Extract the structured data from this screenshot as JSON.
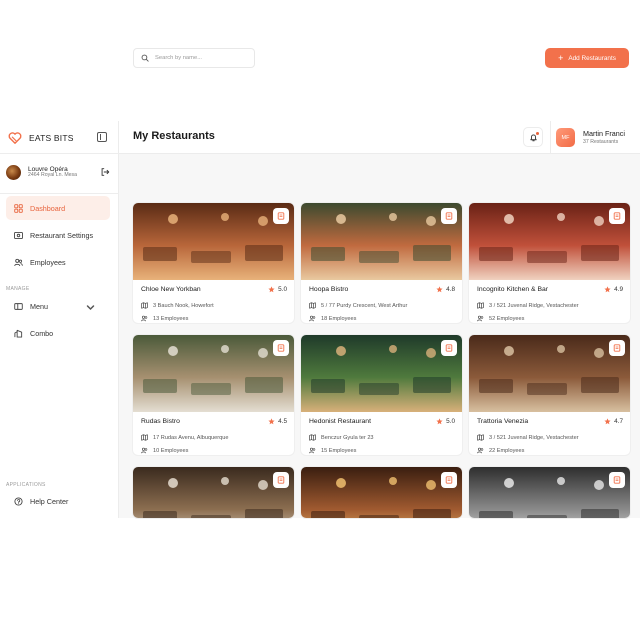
{
  "brand": {
    "name": "EATS BITS",
    "logo_icon": "heart-slice-logo",
    "accent": "#f2714b"
  },
  "location": {
    "name": "Louvre Opéra",
    "address": "2464 Royal Ln. Mesa"
  },
  "nav": {
    "items": [
      {
        "label": "Dashboard",
        "icon": "grid-icon",
        "active": true
      },
      {
        "label": "Restaurant Settings",
        "icon": "settings-card-icon",
        "active": false
      },
      {
        "label": "Employees",
        "icon": "users-icon",
        "active": false
      }
    ],
    "manage_label": "MANAGE",
    "manage_items": [
      {
        "label": "Menu",
        "icon": "menu-book-icon",
        "has_dropdown": true
      },
      {
        "label": "Combo",
        "icon": "combo-icon",
        "has_dropdown": false
      }
    ],
    "applications_label": "APPLICATIONS",
    "app_items": [
      {
        "label": "Help Center",
        "icon": "help-circle-icon"
      }
    ]
  },
  "header": {
    "title": "My Restaurants",
    "user": {
      "initials": "MF",
      "name": "Martin Franci",
      "subtitle": "37 Restaurants"
    }
  },
  "search": {
    "placeholder": "Search by name..."
  },
  "add_button": {
    "label": "Add Restaurants"
  },
  "restaurants": [
    {
      "name": "Chloe New Yorkban",
      "rating": "5.0",
      "address": "3 Bauch Nook, Howefort",
      "employees": "13 Employees",
      "palette": [
        "#5a2b15",
        "#b8663a",
        "#e8b27a"
      ]
    },
    {
      "name": "Hoopa Bistro",
      "rating": "4.8",
      "address": "5 / 77 Purdy Crescent, West Arthur",
      "employees": "18 Employees",
      "palette": [
        "#3d4a2f",
        "#c06a3f",
        "#e9c9a0"
      ]
    },
    {
      "name": "Incognito Kitchen & Bar",
      "rating": "4.9",
      "address": "3 / 521 Juvenal Ridge, Vestachester",
      "employees": "52 Employees",
      "palette": [
        "#6a2216",
        "#c0503a",
        "#f0d2c0"
      ]
    },
    {
      "name": "Rudas Bistro",
      "rating": "4.5",
      "address": "17 Rudas Avenu, Albuquerque",
      "employees": "10 Employees",
      "palette": [
        "#4b5a3a",
        "#a69070",
        "#e4ded2"
      ]
    },
    {
      "name": "Hedonist Restaurant",
      "rating": "5.0",
      "address": "Benczur Gyula ter 23",
      "employees": "15 Employees",
      "palette": [
        "#1f3a2a",
        "#4f7a3d",
        "#d8b07a"
      ]
    },
    {
      "name": "Trattoria Venezia",
      "rating": "4.7",
      "address": "3 / 521 Juvenal Ridge, Vestachester",
      "employees": "22 Employees",
      "palette": [
        "#4a2a1a",
        "#8b5a3a",
        "#d8c0a0"
      ]
    },
    {
      "name": "",
      "rating": "",
      "address": "",
      "employees": "",
      "palette": [
        "#3a2a1e",
        "#8c6e50",
        "#e6ddd0"
      ]
    },
    {
      "name": "",
      "rating": "",
      "address": "",
      "employees": "",
      "palette": [
        "#3a1e10",
        "#a05a30",
        "#f0c070"
      ]
    },
    {
      "name": "",
      "rating": "",
      "address": "",
      "employees": "",
      "palette": [
        "#2e2e2e",
        "#8a8a8a",
        "#e8e8e8"
      ]
    }
  ]
}
